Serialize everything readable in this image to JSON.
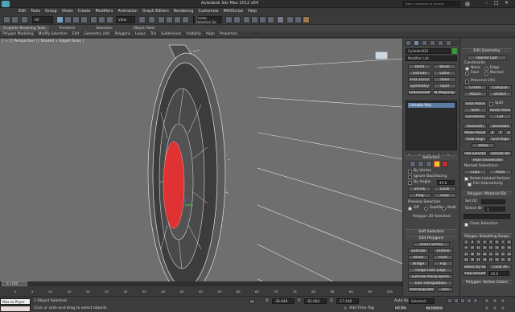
{
  "window": {
    "title": "Autodesk 3ds Max 2012 x64",
    "search_placeholder": "Type a keyword or phrase"
  },
  "menu": [
    "Edit",
    "Tools",
    "Group",
    "Views",
    "Create",
    "Modifiers",
    "Animation",
    "Graph Editors",
    "Rendering",
    "Customize",
    "MAXScript",
    "Help"
  ],
  "toolbar": {
    "select_filter": "All",
    "view_dropdown": "View",
    "named_selection": "Create Selection Se"
  },
  "ribbon": {
    "tabs": [
      "Graphite Modeling Tools",
      "Freeform",
      "Selection",
      "Object Paint"
    ],
    "sub_tabs": [
      "Polygon Modeling",
      "Modify Selection",
      "Edit",
      "Geometry (All)",
      "Polygons",
      "Loops",
      "Tris",
      "Subdivision",
      "Visibility",
      "Align",
      "Properties"
    ]
  },
  "viewport": {
    "label": "[ + ] [ Perspective ] [ Shaded + Edged Faces ]"
  },
  "command_panel": {
    "object_name": "Cylinder023",
    "modifier_list": "Modifier List",
    "modifier_buttons": [
      "Bend",
      "Bevel",
      "Extrude",
      "Lathe",
      "FFD 2x2x2",
      "Shell",
      "Symmetry",
      "Taper",
      "TurboSmooth",
      "UVW Mapping Cle"
    ],
    "stack_item": "Editable Poly",
    "selection": {
      "header": "Selection",
      "by_vertex": "By Vertex",
      "ignore_backfacing": "Ignore Backfacing",
      "by_angle": "By Angle:",
      "angle_value": "45.0",
      "shrink": "Shrink",
      "grow": "Grow",
      "ring": "Ring",
      "loop": "Loop",
      "preview_label": "Preview Selection",
      "preview_off": "Off",
      "preview_subobj": "SubObj",
      "preview_multi": "Multi",
      "status": "Polygon 20 Selected"
    },
    "soft_selection": "Soft Selection",
    "edit_polygons": {
      "header": "Edit Polygons",
      "insert_vertex": "Insert Vertex",
      "extrude": "Extrude",
      "outline": "Outline",
      "bevel": "Bevel",
      "inset": "Inset",
      "bridge": "Bridge",
      "flip": "Flip",
      "hinge": "Hinge From Edge",
      "extrude_spline": "Extrude Along Spline",
      "edit_tri": "Edit Triangulation",
      "retriangulate": "Retriangulate",
      "turn": "Turn"
    }
  },
  "edit_geometry": {
    "header": "Edit Geometry",
    "repeat_last": "Repeat Last",
    "constraints": "Constraints",
    "c_none": "None",
    "c_edge": "Edge",
    "c_face": "Face",
    "c_normal": "Normal",
    "preserve_uvs": "Preserve UVs",
    "create": "Create",
    "collapse": "Collapse",
    "attach": "Attach",
    "detach": "Detach",
    "slice_plane": "Slice Plane",
    "split": "Split",
    "slice": "Slice",
    "reset_plane": "Reset Plane",
    "quickslice": "QuickSlice",
    "cut": "Cut",
    "msmooth": "MSmooth",
    "tessellate": "Tessellate",
    "make_planar": "Make Planar",
    "x": "X",
    "y": "Y",
    "z": "Z",
    "view_align": "View Align",
    "grid_align": "Grid Align",
    "relax": "Relax",
    "hide_selected": "Hide Selected",
    "unhide_all": "Unhide All",
    "hide_unselected": "Hide Unselected",
    "named_selections": "Named Selections:",
    "copy": "Copy",
    "paste": "Paste",
    "delete_isolated": "Delete Isolated Vertices",
    "full_interactivity": "Full Interactivity"
  },
  "material_ids": {
    "header": "Polygon: Material IDs",
    "set_id": "Set ID:",
    "select_id": "Select ID",
    "select_id_value": "1",
    "clear_selection": "Clear Selection"
  },
  "smoothing_groups": {
    "header": "Polygon: Smoothing Groups",
    "groups": [
      "1",
      "2",
      "3",
      "4",
      "5",
      "6",
      "7",
      "8",
      "9",
      "10",
      "11",
      "12",
      "13",
      "14",
      "15",
      "16",
      "17",
      "18",
      "19",
      "20",
      "21",
      "22",
      "23",
      "24",
      "25",
      "26",
      "27",
      "28",
      "29",
      "30",
      "31",
      "32"
    ],
    "select_by_sg": "Select By SG",
    "clear_all": "Clear All",
    "auto_smooth": "Auto Smooth",
    "auto_smooth_value": "45.0"
  },
  "vertex_colors": {
    "header": "Polygon: Vertex Colors"
  },
  "timeline": {
    "frame": "0 / 100",
    "ticks": [
      "0",
      "5",
      "10",
      "15",
      "20",
      "25",
      "30",
      "35",
      "40",
      "45",
      "50",
      "55",
      "60",
      "65",
      "70",
      "75",
      "80",
      "85",
      "90",
      "95",
      "100"
    ]
  },
  "status": {
    "listener": "Max to Physc",
    "objects_selected": "1 Object Selected",
    "prompt": "Click or click-and-drag to select objects",
    "x_label": "X:",
    "x_value": "-36.848",
    "y_label": "Y:",
    "y_value": "-62.684",
    "z_label": "Z:",
    "z_value": "-17.446",
    "add_time_tag": "Add Time Tag",
    "auto_key": "Auto Key",
    "selected": "Selected",
    "set_key": "Set Key",
    "key_filters": "Key Filters..."
  }
}
